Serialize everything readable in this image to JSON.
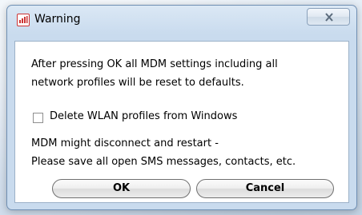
{
  "window": {
    "title": "Warning",
    "close_icon": "close-x-icon",
    "app_icon": "wireless-signal-icon"
  },
  "message": {
    "line1": "After pressing OK all MDM settings including all",
    "line2": "network profiles will be reset to defaults."
  },
  "checkbox": {
    "label": "Delete WLAN profiles from Windows",
    "checked": false
  },
  "note": {
    "line1": "MDM might disconnect and restart -",
    "line2": "Please save all open SMS messages, contacts, etc."
  },
  "buttons": {
    "ok": "OK",
    "cancel": "Cancel"
  }
}
